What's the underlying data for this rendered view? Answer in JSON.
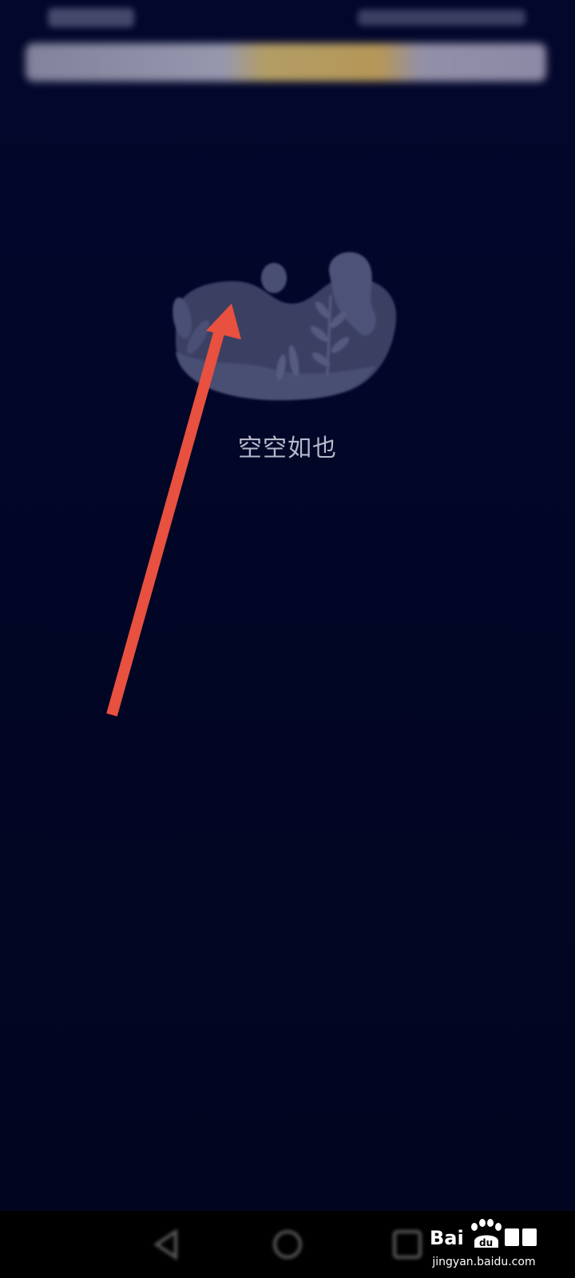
{
  "empty_state": {
    "message": "空空如也",
    "illustration_icon": "empty-box-illustration-icon"
  },
  "annotation": {
    "type": "arrow",
    "color": "#e8503f"
  },
  "navigation": {
    "back_icon": "back-triangle-icon",
    "home_icon": "home-circle-icon",
    "recent_icon": "recent-square-icon"
  },
  "watermark": {
    "logo_icon": "baidu-paw-icon",
    "url": "jingyan.baidu.com"
  },
  "colors": {
    "background": "#02062a",
    "text": "#b6b9ca",
    "arrow": "#e8503f"
  }
}
